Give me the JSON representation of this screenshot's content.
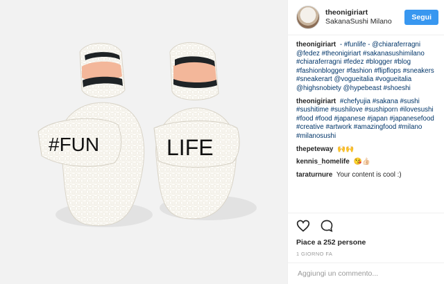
{
  "post": {
    "username": "theonigiriart",
    "location": "SakanaSushi Milano",
    "follow_label": "Segui",
    "photo_text_left": "#FUN",
    "photo_text_right": "LIFE"
  },
  "comments": [
    {
      "user": "theonigiriart",
      "text": "- #funlife - @chiaraferragni @fedez #theonigiriart #sakanasushimilano #chiaraferragni #fedez #blogger #blog #fashionblogger #fashion #flipflops #sneakers #sneakerart @vogueitalia #vogueitalia @highsnobiety @hypebeast #shoeshi"
    },
    {
      "user": "theonigiriart",
      "text": "#chefyujia #sakana #sushi #sushitime #sushilove #sushiporn #ilovesushi #food #food #japanese #japan #japanesefood #creative #artwork #amazingfood #milano #milanosushi"
    },
    {
      "user": "thepeteway",
      "text": "🙌🙌"
    },
    {
      "user": "kennis_homelife",
      "text": "😘👍🏻"
    },
    {
      "user": "taraturnure",
      "text": "Your content is cool :)"
    }
  ],
  "actions": {
    "like_icon": "heart-icon",
    "comment_icon": "comment-icon",
    "likes_text": "Piace a 252 persone",
    "timestamp": "1 GIORNO FA",
    "comment_placeholder": "Aggiungi un commento..."
  }
}
